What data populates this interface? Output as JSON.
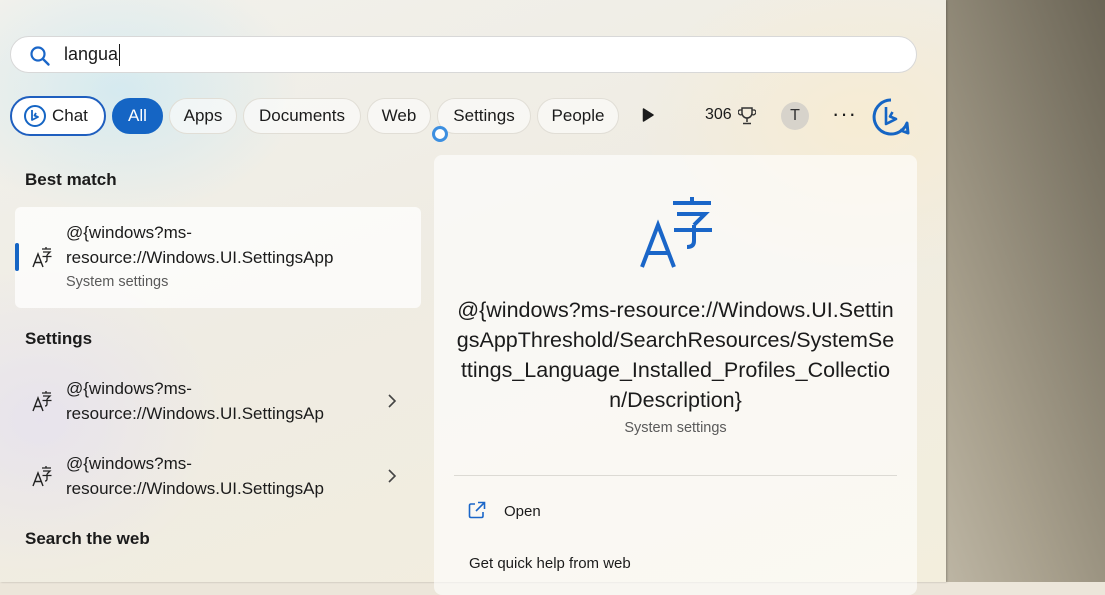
{
  "search": {
    "value": "langua",
    "placeholder": ""
  },
  "filters": {
    "chat": "Chat",
    "all": "All",
    "apps": "Apps",
    "documents": "Documents",
    "web": "Web",
    "settings": "Settings",
    "people": "People"
  },
  "rewards": {
    "points": "306"
  },
  "account": {
    "initial": "T"
  },
  "more": "···",
  "sections": {
    "best_match": "Best match",
    "settings": "Settings",
    "search_web": "Search the web"
  },
  "best_match": {
    "line1": "@{windows?ms-",
    "line2": "resource://Windows.UI.SettingsApp",
    "subtitle": "System settings"
  },
  "settings_items": [
    {
      "line1": "@{windows?ms-",
      "line2": "resource://Windows.UI.SettingsAp"
    },
    {
      "line1": "@{windows?ms-",
      "line2": "resource://Windows.UI.SettingsAp"
    }
  ],
  "detail": {
    "title": "@{windows?ms-resource://Windows.UI.SettingsAppThreshold/SearchResources/SystemSettings_Language_Installed_Profiles_Collection/Description}",
    "subtitle": "System settings",
    "open": "Open",
    "quick_help": "Get quick help from web"
  },
  "colors": {
    "accent": "#1565c4",
    "icon_blue": "#1a66c8"
  },
  "icons": [
    "search-icon",
    "bing-chat-icon",
    "play-icon",
    "trophy-icon",
    "more-icon",
    "language-icon",
    "chevron-right-icon",
    "open-external-icon",
    "loading-spinner-icon"
  ]
}
